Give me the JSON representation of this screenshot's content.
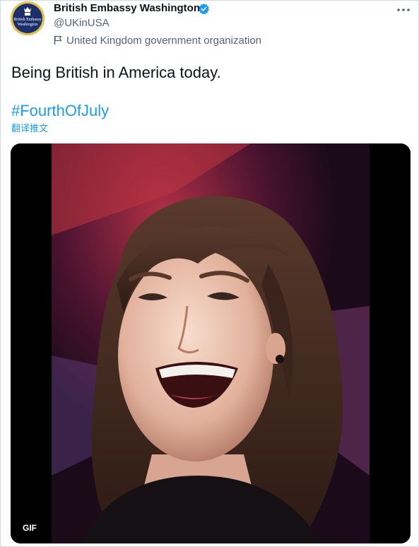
{
  "account": {
    "avatar_text_line1": "British Embassy",
    "avatar_text_line2": "Washington",
    "display_name": "British Embassy Washington",
    "handle": "@UKinUSA",
    "label": "United Kingdom government organization",
    "verified_icon": "verified-badge-icon",
    "label_icon": "flag-icon"
  },
  "tweet": {
    "text": "Being British in America today.",
    "hashtag": "#FourthOfJuly",
    "translate_label": "翻译推文"
  },
  "media": {
    "badge": "GIF",
    "description_icon": "gif-still-woman-laughing"
  },
  "colors": {
    "accent": "#1d9bf0",
    "secondary_text": "#536471",
    "primary_text": "#0f1419",
    "avatar_bg": "#1d2f6b"
  }
}
